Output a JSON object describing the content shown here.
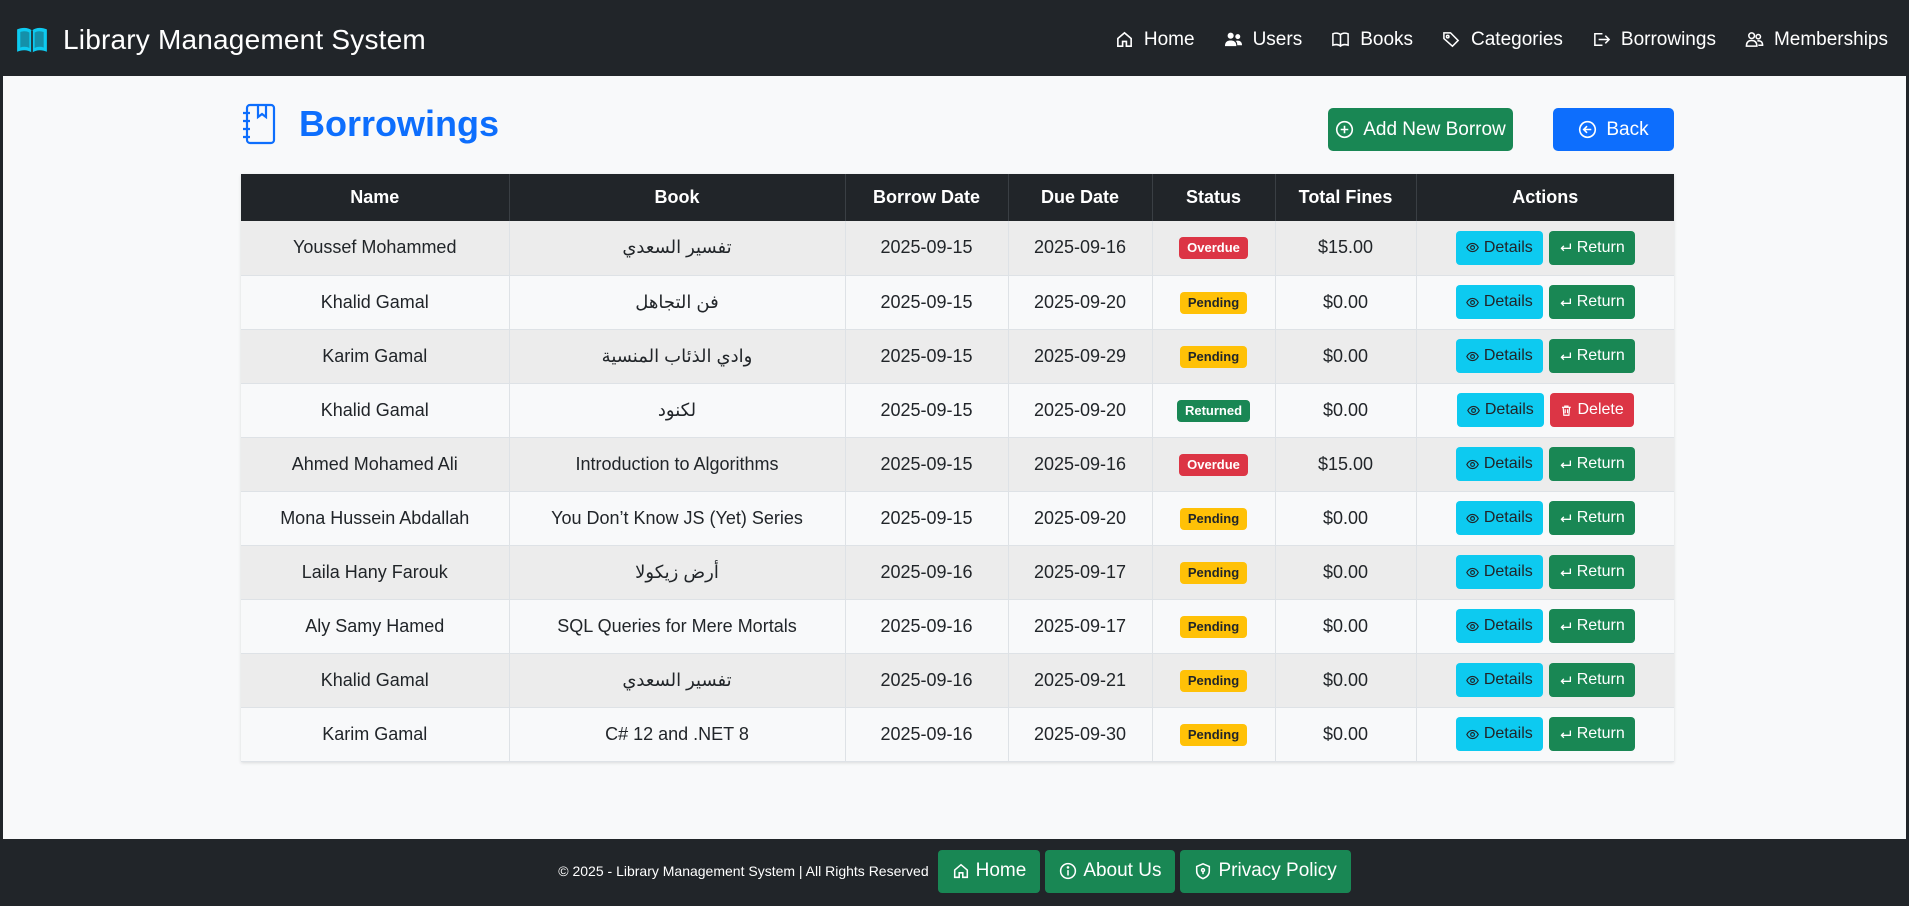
{
  "app": {
    "title": "Library Management System"
  },
  "nav": {
    "items": [
      {
        "label": "Home",
        "icon": "house-icon"
      },
      {
        "label": "Users",
        "icon": "users-icon"
      },
      {
        "label": "Books",
        "icon": "book-open-icon"
      },
      {
        "label": "Categories",
        "icon": "tags-icon"
      },
      {
        "label": "Borrowings",
        "icon": "box-arrow-right-icon"
      },
      {
        "label": "Memberships",
        "icon": "person-badge-icon"
      }
    ]
  },
  "page": {
    "title": "Borrowings",
    "add_label": "Add New Borrow",
    "back_label": "Back"
  },
  "table": {
    "headers": [
      "Name",
      "Book",
      "Borrow Date",
      "Due Date",
      "Status",
      "Total Fines",
      "Actions"
    ],
    "rows": [
      {
        "name": "Youssef Mohammed",
        "book": "تفسير السعدي",
        "borrow_date": "2025-09-15",
        "due_date": "2025-09-16",
        "status": "Overdue",
        "fines": "$15.00",
        "action1": "Details",
        "action2": "Return"
      },
      {
        "name": "Khalid Gamal",
        "book": "فن التجاهل",
        "borrow_date": "2025-09-15",
        "due_date": "2025-09-20",
        "status": "Pending",
        "fines": "$0.00",
        "action1": "Details",
        "action2": "Return"
      },
      {
        "name": "Karim Gamal",
        "book": "وادي الذئاب المنسية",
        "borrow_date": "2025-09-15",
        "due_date": "2025-09-29",
        "status": "Pending",
        "fines": "$0.00",
        "action1": "Details",
        "action2": "Return"
      },
      {
        "name": "Khalid Gamal",
        "book": "لكنود",
        "borrow_date": "2025-09-15",
        "due_date": "2025-09-20",
        "status": "Returned",
        "fines": "$0.00",
        "action1": "Details",
        "action2": "Delete"
      },
      {
        "name": "Ahmed Mohamed Ali",
        "book": "Introduction to Algorithms",
        "borrow_date": "2025-09-15",
        "due_date": "2025-09-16",
        "status": "Overdue",
        "fines": "$15.00",
        "action1": "Details",
        "action2": "Return"
      },
      {
        "name": "Mona Hussein Abdallah",
        "book": "You Don’t Know JS (Yet) Series",
        "borrow_date": "2025-09-15",
        "due_date": "2025-09-20",
        "status": "Pending",
        "fines": "$0.00",
        "action1": "Details",
        "action2": "Return"
      },
      {
        "name": "Laila Hany Farouk",
        "book": "أرض زيكولا",
        "borrow_date": "2025-09-16",
        "due_date": "2025-09-17",
        "status": "Pending",
        "fines": "$0.00",
        "action1": "Details",
        "action2": "Return"
      },
      {
        "name": "Aly Samy Hamed",
        "book": "SQL Queries for Mere Mortals",
        "borrow_date": "2025-09-16",
        "due_date": "2025-09-17",
        "status": "Pending",
        "fines": "$0.00",
        "action1": "Details",
        "action2": "Return"
      },
      {
        "name": "Khalid Gamal",
        "book": "تفسير السعدي",
        "borrow_date": "2025-09-16",
        "due_date": "2025-09-21",
        "status": "Pending",
        "fines": "$0.00",
        "action1": "Details",
        "action2": "Return"
      },
      {
        "name": "Karim Gamal",
        "book": "C# 12 and .NET 8",
        "borrow_date": "2025-09-16",
        "due_date": "2025-09-30",
        "status": "Pending",
        "fines": "$0.00",
        "action1": "Details",
        "action2": "Return"
      }
    ]
  },
  "footer": {
    "copyright": "© 2025 - Library Management System | All Rights Reserved",
    "links": [
      {
        "label": "Home",
        "icon": "house-icon"
      },
      {
        "label": "About Us",
        "icon": "info-circle-icon"
      },
      {
        "label": "Privacy Policy",
        "icon": "shield-icon"
      }
    ]
  },
  "colors": {
    "navbar": "#212529",
    "primary": "#0d6efd",
    "success": "#198754",
    "danger": "#dc3545",
    "warning": "#ffc107",
    "info": "#0dcaf0",
    "brand_icon": "#0dcaf0"
  }
}
